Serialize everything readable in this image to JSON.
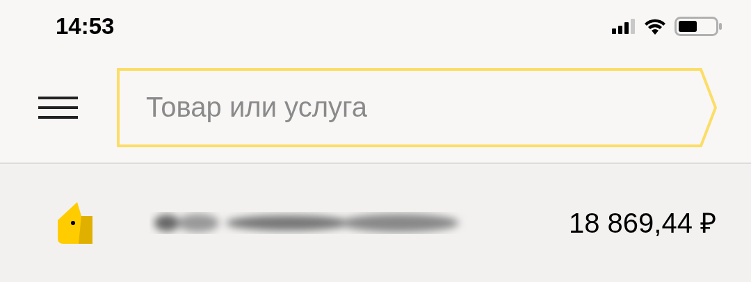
{
  "status_bar": {
    "time": "14:53"
  },
  "search": {
    "placeholder": "Товар или услуга"
  },
  "wallet": {
    "balance": "18 869,44 ₽"
  }
}
